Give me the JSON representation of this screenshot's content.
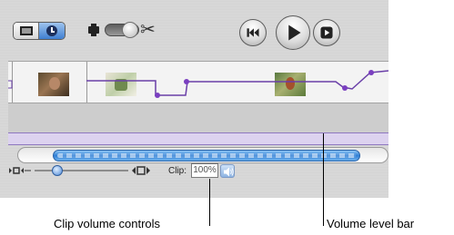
{
  "toolbar": {
    "mode_toggle": {
      "options": [
        {
          "icon": "clip-viewer-icon",
          "selected": false
        },
        {
          "icon": "timeline-viewer-icon",
          "selected": true
        }
      ]
    },
    "camera_switch": {
      "left_icon": "camera-icon",
      "right_icon": "scissors-icon"
    },
    "playback_buttons": [
      {
        "icon": "rewind-icon"
      },
      {
        "icon": "play-icon"
      },
      {
        "icon": "play-fullscreen-icon"
      }
    ]
  },
  "timeline": {
    "clips": [
      {
        "icon": "clip-thumbnail"
      },
      {
        "icon": "clip-thumbnail"
      },
      {
        "icon": "clip-thumbnail"
      }
    ],
    "volume_curve_color": "#6a3fa8"
  },
  "scrubber": {
    "accent": "#2f7fd6"
  },
  "zoom": {
    "min_icon": "zoom-small-icon",
    "max_icon": "zoom-large-icon"
  },
  "clip_volume": {
    "label": "Clip:",
    "value": "100%",
    "icon": "speaker-icon"
  },
  "callouts": {
    "clip_volume_controls": "Clip volume controls",
    "volume_level_bar": "Volume level bar"
  }
}
